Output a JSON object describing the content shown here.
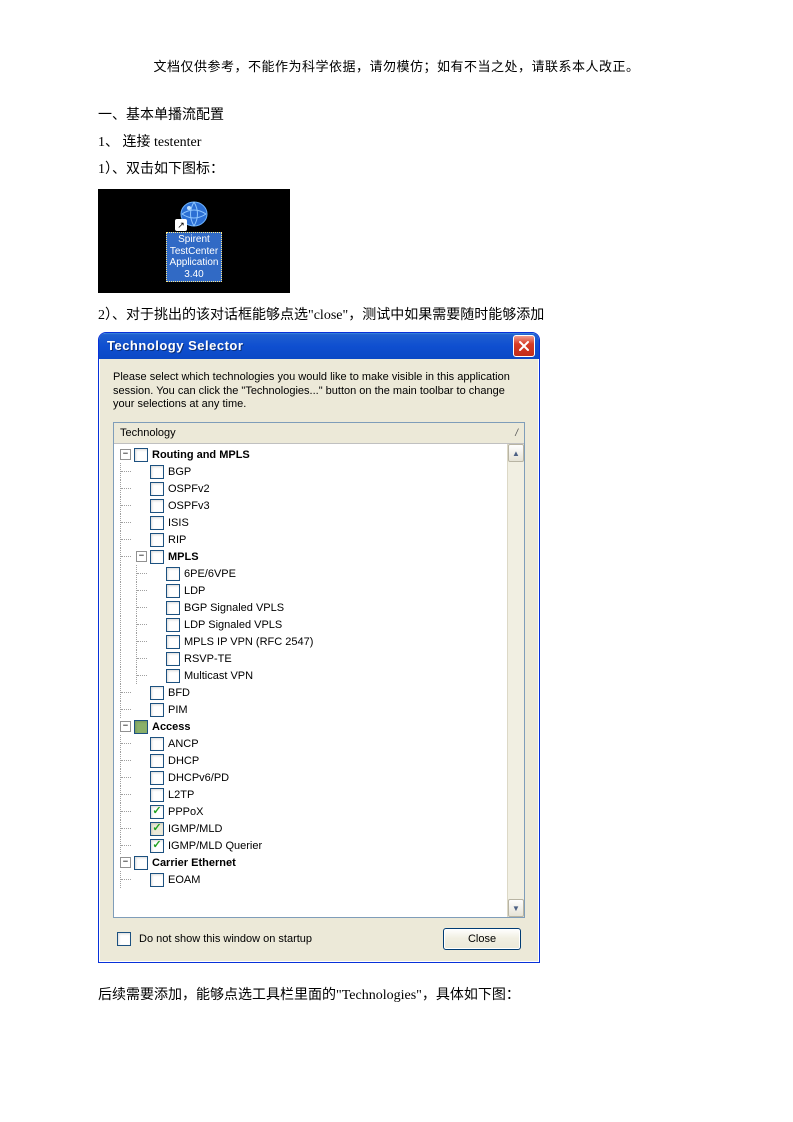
{
  "disclaimer": "文档仅供参考，不能作为科学依据，请勿模仿；如有不当之处，请联系本人改正。",
  "heading1": "一、基本单播流配置",
  "step1": "1、 连接 testenter",
  "step1_1": "1）、双击如下图标：",
  "desktop": {
    "line1": "Spirent",
    "line2": "TestCenter",
    "line3": "Application",
    "line4": "3.40"
  },
  "step1_2": "2）、对于挑出的该对话框能够点选\"close\"，测试中如果需要随时能够添加",
  "dialog": {
    "title": "Technology Selector",
    "intro": "Please select which technologies you would like to make visible in this application session. You can click the \"Technologies...\" button on the main toolbar to change your selections at any time.",
    "header": "Technology",
    "header_right": "/",
    "tree": [
      {
        "level": 0,
        "exp": "-",
        "bold": true,
        "label": "Routing and MPLS"
      },
      {
        "level": 1,
        "label": "BGP"
      },
      {
        "level": 1,
        "label": "OSPFv2"
      },
      {
        "level": 1,
        "label": "OSPFv3"
      },
      {
        "level": 1,
        "label": "ISIS"
      },
      {
        "level": 1,
        "label": "RIP"
      },
      {
        "level": 1,
        "exp": "-",
        "bold": true,
        "label": "MPLS"
      },
      {
        "level": 2,
        "label": "6PE/6VPE"
      },
      {
        "level": 2,
        "label": "LDP"
      },
      {
        "level": 2,
        "label": "BGP Signaled VPLS"
      },
      {
        "level": 2,
        "label": "LDP Signaled VPLS"
      },
      {
        "level": 2,
        "label": "MPLS IP VPN (RFC 2547)"
      },
      {
        "level": 2,
        "label": "RSVP-TE"
      },
      {
        "level": 2,
        "label": "Multicast VPN"
      },
      {
        "level": 1,
        "label": "BFD"
      },
      {
        "level": 1,
        "label": "PIM"
      },
      {
        "level": 0,
        "exp": "-",
        "bold": true,
        "fill": true,
        "label": "Access"
      },
      {
        "level": 1,
        "label": "ANCP"
      },
      {
        "level": 1,
        "label": "DHCP"
      },
      {
        "level": 1,
        "label": "DHCPv6/PD"
      },
      {
        "level": 1,
        "label": "L2TP"
      },
      {
        "level": 1,
        "checked": true,
        "label": "PPPoX"
      },
      {
        "level": 1,
        "gray": true,
        "checked": true,
        "label": "IGMP/MLD"
      },
      {
        "level": 1,
        "checked": true,
        "label": "IGMP/MLD Querier"
      },
      {
        "level": 0,
        "exp": "-",
        "bold": true,
        "label": "Carrier Ethernet"
      },
      {
        "level": 1,
        "label": "EOAM"
      }
    ],
    "footer_cb": "Do not show this window on startup",
    "close_btn": "Close"
  },
  "para_after": "后续需要添加，能够点选工具栏里面的\"Technologies\"，具体如下图："
}
